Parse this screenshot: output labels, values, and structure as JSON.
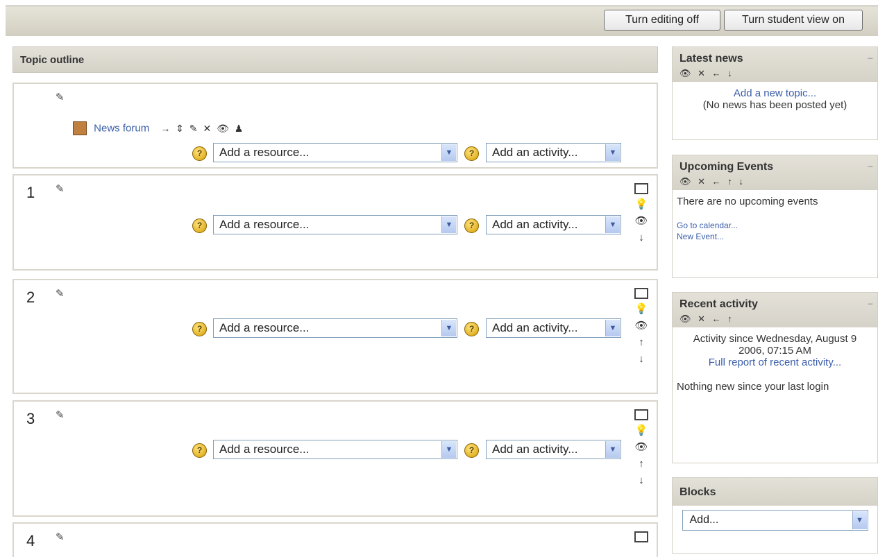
{
  "header": {
    "turn_editing_label": "Turn editing off",
    "turn_student_view_label": "Turn student view on"
  },
  "outline": {
    "title": "Topic outline",
    "news_forum_label": "News forum",
    "news_forum_controls": "→ ⇕ ✎ ✕ 👁 ♟",
    "add_resource_placeholder": "Add a resource...",
    "add_activity_placeholder": "Add an activity...",
    "sections": [
      "1",
      "2",
      "3",
      "4"
    ]
  },
  "blocks": {
    "latest_news": {
      "title": "Latest news",
      "controls": "👁 ✕ ← ↓",
      "add_topic": "Add a new topic...",
      "empty": "(No news has been posted yet)"
    },
    "upcoming_events": {
      "title": "Upcoming Events",
      "controls": "👁 ✕ ← ↑ ↓",
      "empty": "There are no upcoming events",
      "goto_calendar": "Go to calendar...",
      "new_event": "New Event..."
    },
    "recent_activity": {
      "title": "Recent activity",
      "controls": "👁 ✕ ← ↑",
      "since": "Activity since Wednesday, August 9 2006, 07:15 AM",
      "full_report": "Full report of recent activity...",
      "nothing_new": "Nothing new since your last login"
    },
    "blocks_block": {
      "title": "Blocks",
      "add_placeholder": "Add..."
    }
  }
}
